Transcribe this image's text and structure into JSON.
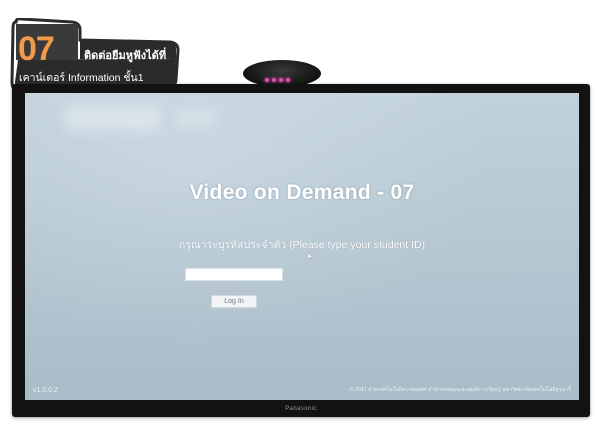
{
  "sticker": {
    "number": "07",
    "line1": "ติดต่อยืมหูฟังได้ที่",
    "line2": "เคาน์เตอร์ Information ชั้น1"
  },
  "app": {
    "title": "Video on Demand - 07",
    "prompt": "กรุณาระบุรหัสประจำตัว (Please type your student ID)",
    "input_value": "",
    "login_label": "Log In",
    "version": "v1.0.0.2",
    "copyright": "© 2017 ฝ่ายเทคโนโลยีสารสนเทศ สำนักหอสมุดและศูนย์การเรียนรู้ มหาวิทยาลัยเทคโนโลยีสุรนารี"
  },
  "tv": {
    "brand": "Panasonic"
  },
  "icons": {
    "camera": "camera-icon",
    "cursor": "mouse-cursor-icon"
  },
  "colors": {
    "screen_bg": "#b7c8d3",
    "sticker_dark": "#2b2b2b",
    "sticker_accent": "#f39a4a",
    "camera_light": "#e04aa8"
  }
}
